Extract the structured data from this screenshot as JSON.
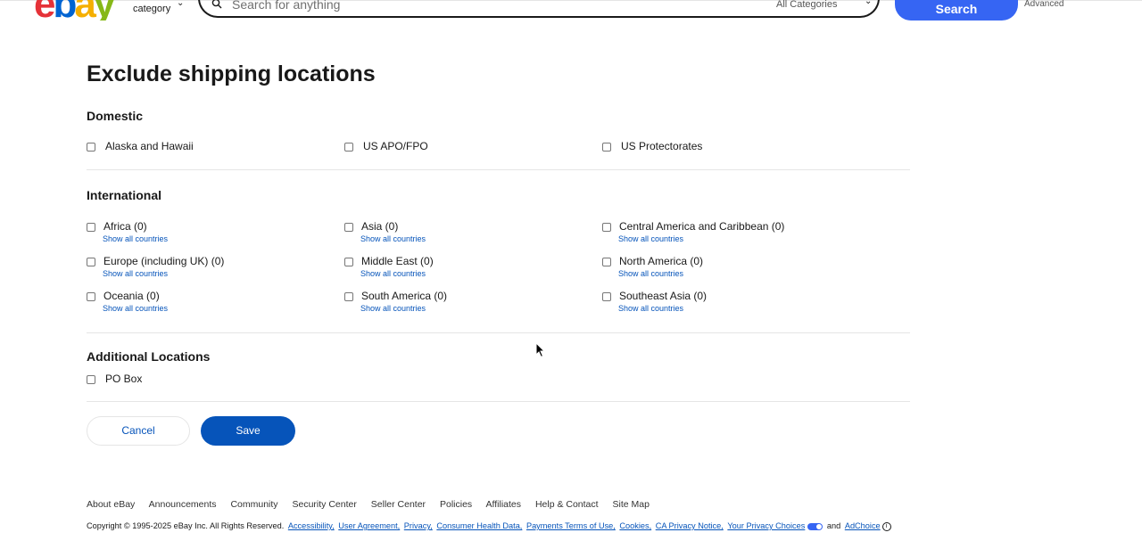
{
  "header": {
    "logo_letters": [
      "e",
      "b",
      "a",
      "y"
    ],
    "shop_by_category": "category",
    "search_placeholder": "Search for anything",
    "all_categories": "All Categories",
    "search_button": "Search",
    "advanced": "Advanced"
  },
  "page": {
    "title": "Exclude shipping locations"
  },
  "domestic": {
    "title": "Domestic",
    "items": [
      {
        "label": "Alaska and Hawaii"
      },
      {
        "label": "US APO/FPO"
      },
      {
        "label": "US Protectorates"
      }
    ]
  },
  "international": {
    "title": "International",
    "show_all": "Show all countries",
    "items": [
      {
        "label": "Africa (0)"
      },
      {
        "label": "Asia (0)"
      },
      {
        "label": "Central America and Caribbean (0)"
      },
      {
        "label": "Europe (including UK) (0)"
      },
      {
        "label": "Middle East (0)"
      },
      {
        "label": "North America (0)"
      },
      {
        "label": "Oceania (0)"
      },
      {
        "label": "South America (0)"
      },
      {
        "label": "Southeast Asia (0)"
      }
    ]
  },
  "additional": {
    "title": "Additional Locations",
    "items": [
      {
        "label": "PO Box"
      }
    ]
  },
  "actions": {
    "cancel": "Cancel",
    "save": "Save"
  },
  "footer": {
    "links": [
      "About eBay",
      "Announcements",
      "Community",
      "Security Center",
      "Seller Center",
      "Policies",
      "Affiliates",
      "Help & Contact",
      "Site Map"
    ],
    "copyright": "Copyright © 1995-2025 eBay Inc. All Rights Reserved.",
    "legal_links": [
      "Accessibility,",
      "User Agreement,",
      "Privacy,",
      "Consumer Health Data,",
      "Payments Terms of Use,",
      "Cookies,",
      "CA Privacy Notice,",
      "Your Privacy Choices"
    ],
    "and_text": "and",
    "adchoice": "AdChoice"
  },
  "colors": {
    "primary_blue": "#0654ba",
    "search_blue": "#3665f3",
    "logo_e": "#e53238",
    "logo_b": "#0064d2",
    "logo_a": "#f5af02",
    "logo_y": "#86b817"
  }
}
